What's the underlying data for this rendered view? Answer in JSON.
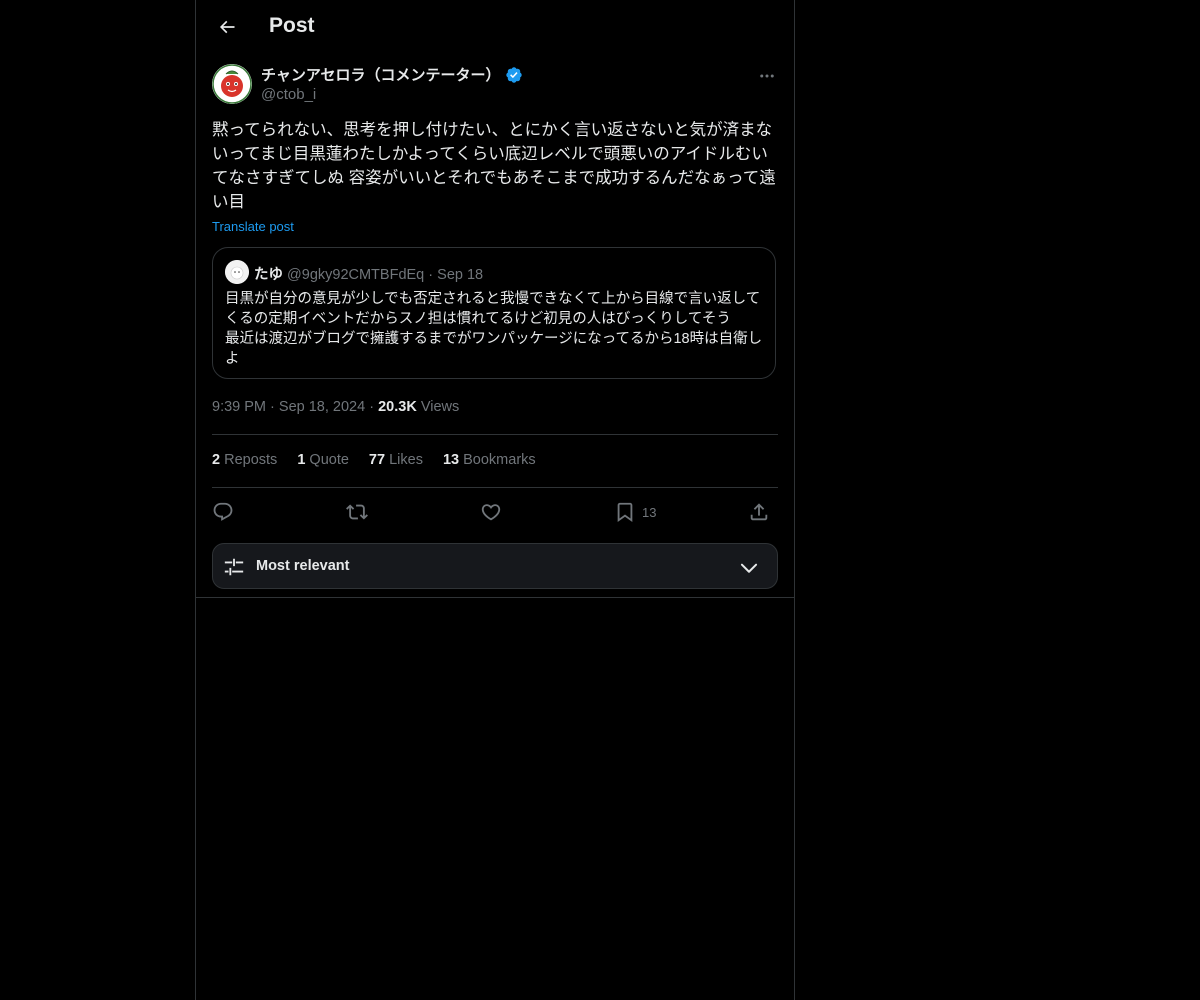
{
  "header": {
    "back_icon": "arrow-left-icon",
    "title": "Post"
  },
  "post": {
    "author_name": "チャンアセロラ（コメンテーター）",
    "author_handle": "@ctob_i",
    "verified_icon": "verified-badge-icon",
    "more_icon": "more-horizontal-icon",
    "text": "黙ってられない、思考を押し付けたい、とにかく言い返さないと気が済まないってまじ目黒蓮わたしかよってくらい底辺レベルで頭悪いのアイドルむいてなさすぎてしぬ 容姿がいいとそれでもあそこまで成功するんだなぁって遠い目",
    "translate_label": "Translate post",
    "time": "9:39 PM",
    "date": "Sep 18, 2024",
    "separator": "·",
    "views_count": "20.3K",
    "views_label": "Views"
  },
  "quote": {
    "name": "たゆ",
    "handle": "@9gky92CMTBFdEq",
    "separator": "·",
    "date": "Sep 18",
    "text": "目黒が自分の意見が少しでも否定されると我慢できなくて上から目線で言い返してくるの定期イベントだからスノ担は慣れてるけど初見の人はびっくりしてそう\n最近は渡辺がブログで擁護するまでがワンパッケージになってるから18時は自衛しよ"
  },
  "stats": {
    "reposts_count": "2",
    "reposts_label": "Reposts",
    "quotes_count": "1",
    "quotes_label": "Quote",
    "likes_count": "77",
    "likes_label": "Likes",
    "bookmarks_count": "13",
    "bookmarks_label": "Bookmarks"
  },
  "actions": {
    "reply_icon": "reply-icon",
    "repost_icon": "repost-icon",
    "like_icon": "heart-icon",
    "bookmark_icon": "bookmark-icon",
    "bookmark_count": "13",
    "share_icon": "share-icon"
  },
  "sort": {
    "icon": "sliders-icon",
    "label": "Most relevant",
    "chevron": "chevron-down-icon"
  },
  "colors": {
    "background": "#000000",
    "text": "#e7e9ea",
    "muted": "#71767b",
    "link": "#1d9bf0",
    "border": "#2f3336"
  }
}
